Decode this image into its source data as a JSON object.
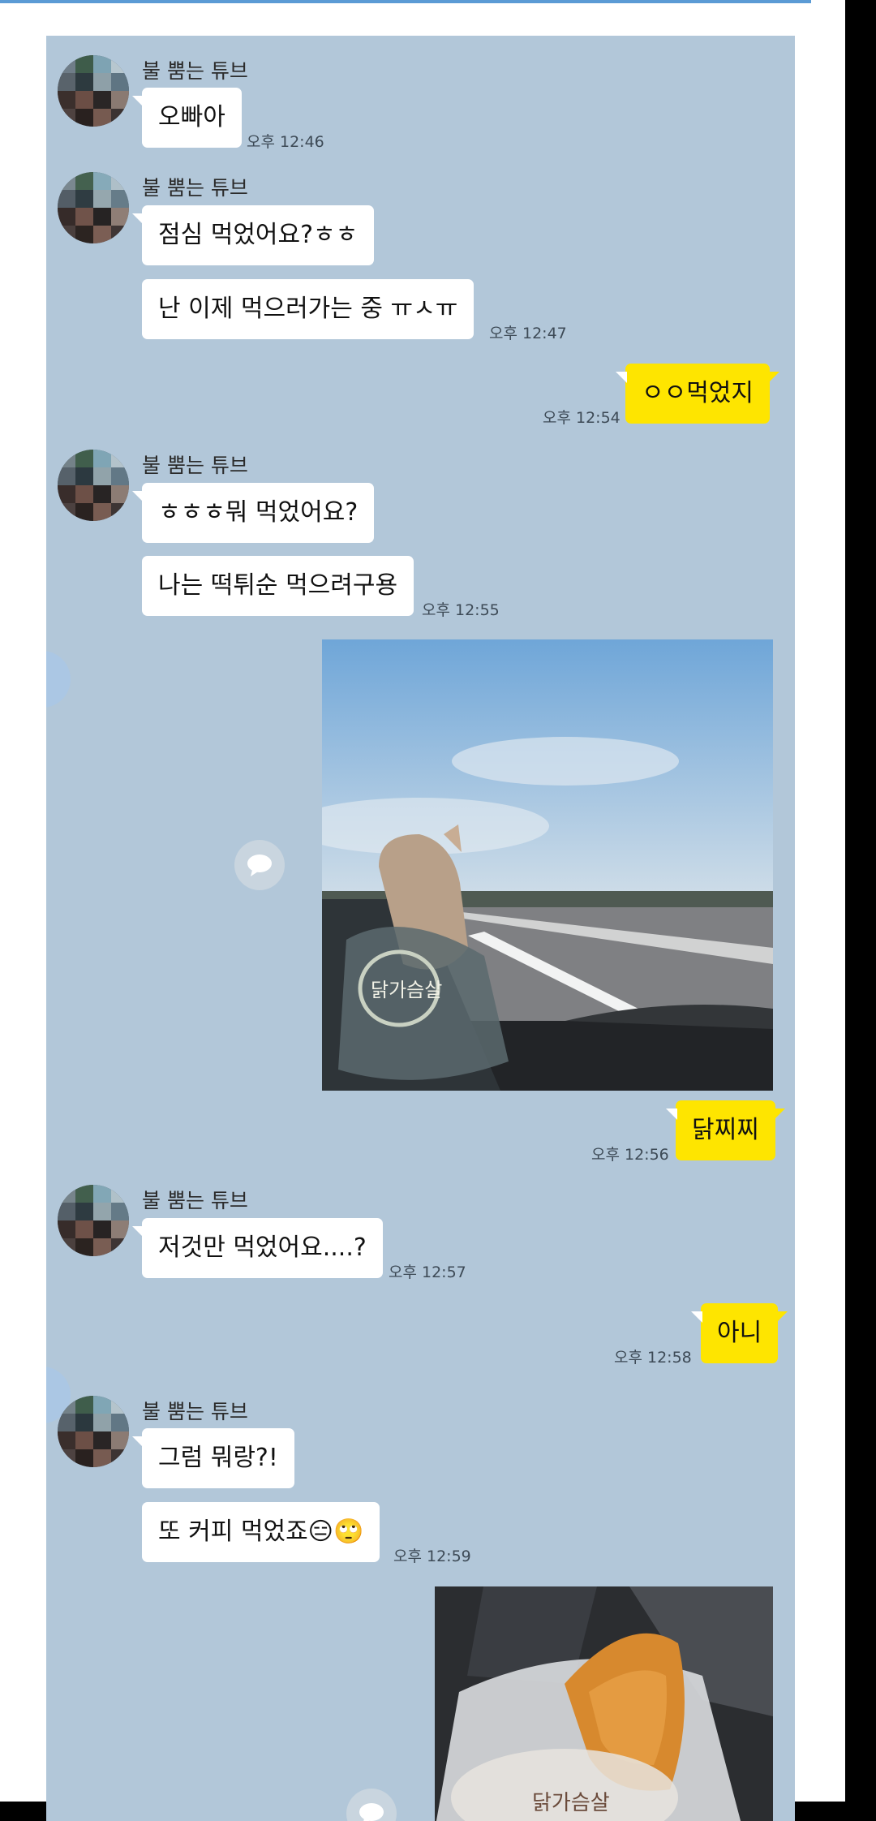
{
  "sender_name": "불 뿜는 튜브",
  "messages": {
    "m1": "오빠아",
    "m2": "점심 먹었어요?ㅎㅎ",
    "m3": "난 이제 먹으러가는 중 ㅠㅅㅠ",
    "m4": "ㅇㅇ먹었지",
    "m5": "ㅎㅎㅎ뭐 먹었어요?",
    "m6": "나는 떡튀순 먹으려구용",
    "m7": "닭찌찌",
    "m8": "저것만 먹었어요....?",
    "m9": "아니",
    "m10": "그럼 뭐랑?!",
    "m11": "또 커피 먹었죠😑🙄"
  },
  "times": {
    "t1": "오후 12:46",
    "t2": "오후 12:47",
    "t3": "오후 12:54",
    "t4": "오후 12:55",
    "t5": "오후 12:56",
    "t6": "오후 12:57",
    "t7": "오후 12:58",
    "t8": "오후 12:59"
  },
  "photo_labels": {
    "package1": "닭가슴살",
    "package2": "닭가슴살"
  },
  "colors": {
    "chat_bg": "#b2c7d9",
    "my_bubble": "#fee500",
    "their_bubble": "#ffffff"
  },
  "icons": [
    "share-icon",
    "avatar-image"
  ]
}
